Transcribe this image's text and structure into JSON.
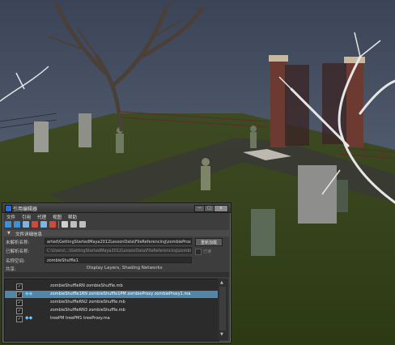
{
  "window": {
    "title": "引用编辑器",
    "min_label": "—",
    "max_label": "□",
    "close_label": "x"
  },
  "menu": [
    "文件",
    "引用",
    "代理",
    "视图",
    "帮助"
  ],
  "section": {
    "label": "文件详细信息"
  },
  "details": {
    "unresolved_label": "未解析名称:",
    "unresolved_value": "arted\\GettingStartedMaya2012LessonData\\FileReferencing\\zombieProxy1.ma",
    "resolved_label": "已解析名称:",
    "resolved_value": "C:\\Users\\...\\GettingStartedMaya2012LessonData\\FileReferencing\\zombieProxy1.ma",
    "namespace_label": "名称空间:",
    "namespace_value": "zombieShuffle1",
    "content_label": "共享:",
    "content_value": "Display Layers, Shading Networks",
    "reload_button": "重新加载",
    "checkbox_label": "已读"
  },
  "references": [
    {
      "checked": "✓",
      "icon": "",
      "label": "zombieShuffleRN zombieShuffle.mb",
      "selected": false
    },
    {
      "checked": "✓",
      "icon": "◆◆",
      "label": "zombieShuffle1RN zombieShuffle1PM  zombieProxy  zombieProxy1.ma",
      "selected": true
    },
    {
      "checked": "✓",
      "icon": "",
      "label": "zombieShuffleRN2 zombieShuffle.mb",
      "selected": false
    },
    {
      "checked": "✓",
      "icon": "",
      "label": "zombieShuffleRN3 zombieShuffle.mb",
      "selected": false
    },
    {
      "checked": "✓",
      "icon": "◆◆",
      "label": "treePM  treePM1  treeProxy.ma",
      "selected": false
    }
  ],
  "scrollbar": {
    "up": "▲",
    "down": "▼"
  },
  "toolbar_icons": [
    "reference-icon",
    "reload-icon",
    "export-icon",
    "proxy-icon",
    "unload-icon",
    "remove-icon",
    "list-view-icon",
    "tree-view-icon",
    "detail-view-icon"
  ]
}
